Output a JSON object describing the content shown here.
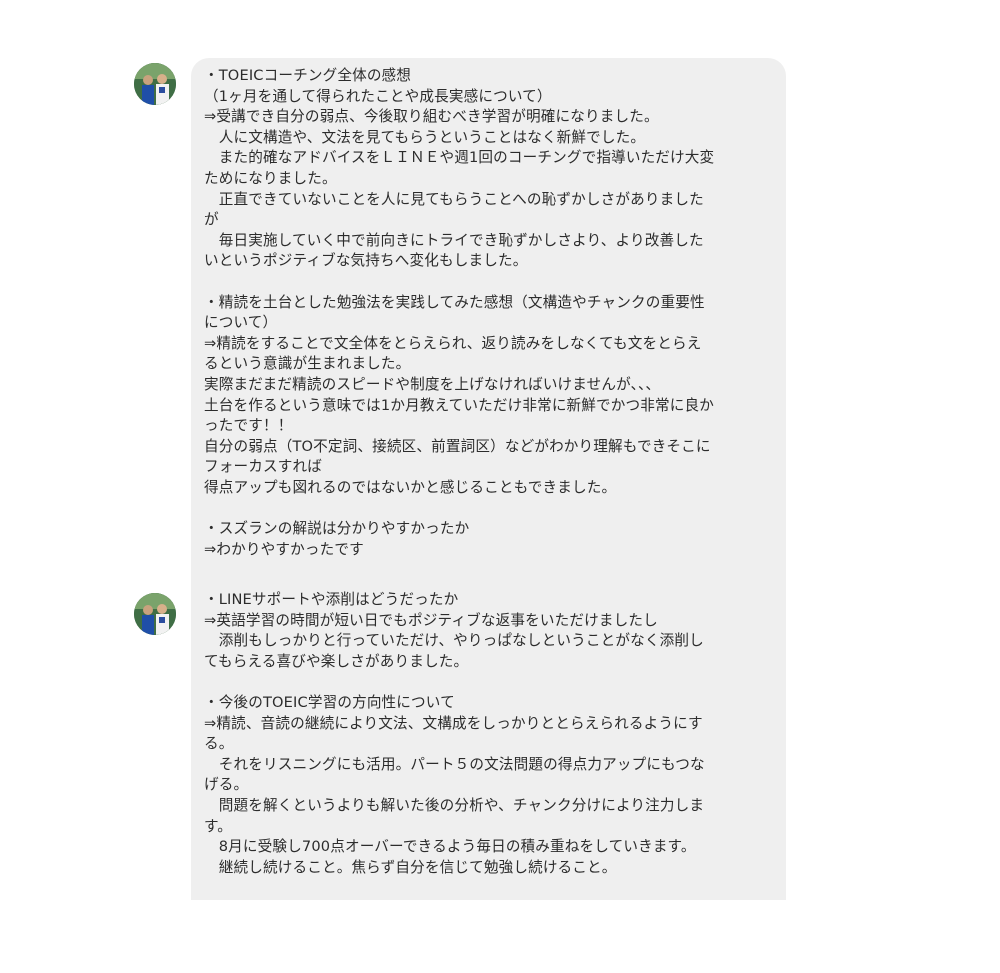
{
  "messages": [
    {
      "lines": [
        "・TOEICコーチング全体の感想",
        "（1ヶ月を通して得られたことや成長実感について）",
        "⇒受講でき自分の弱点、今後取り組むべき学習が明確になりました。",
        "　人に文構造や、文法を見てもらうということはなく新鮮でした。",
        "　また的確なアドバイスをＬＩＮＥや週1回のコーチングで指導いただけ大変",
        "ためになりました。",
        "　正直できていないことを人に見てもらうことへの恥ずかしさがありました",
        "が",
        "　毎日実施していく中で前向きにトライでき恥ずかしさより、より改善した",
        "いというポジティブな気持ちへ変化もしました。",
        "",
        "・精読を土台とした勉強法を実践してみた感想（文構造やチャンクの重要性",
        "について）",
        "⇒精読をすることで文全体をとらえられ、返り読みをしなくても文をとらえ",
        "るという意識が生まれました。",
        "実際まだまだ精読のスピードや制度を上げなければいけませんが、、、",
        "土台を作るという意味では1か月教えていただけ非常に新鮮でかつ非常に良か",
        "ったです！！",
        "自分の弱点（TO不定詞、接続区、前置詞区）などがわかり理解もできそこに",
        "フォーカスすれば",
        "得点アップも図れるのではないかと感じることもできました。",
        "",
        "・スズランの解説は分かりやすかったか",
        "⇒わかりやすかったです"
      ]
    },
    {
      "lines": [
        "・LINEサポートや添削はどうだったか",
        "⇒英語学習の時間が短い日でもポジティブな返事をいただけましたし",
        "　添削もしっかりと行っていただけ、やりっぱなしということがなく添削し",
        "てもらえる喜びや楽しさがありました。",
        "",
        "・今後のTOEIC学習の方向性について",
        "⇒精読、音読の継続により文法、文構成をしっかりととらえられるようにす",
        "る。",
        "　それをリスニングにも活用。パート５の文法問題の得点力アップにもつな",
        "げる。",
        "　問題を解くというよりも解いた後の分析や、チャンク分けにより注力しま",
        "す。",
        "　8月に受験し700点オーバーできるよう毎日の積み重ねをしていきます。",
        "　継続し続けること。焦らず自分を信じて勉強し続けること。"
      ]
    }
  ],
  "avatar_icon": "user-avatar-icon",
  "colors": {
    "bubble_bg": "#efefef",
    "text": "#2c2c2c",
    "page_bg": "#ffffff"
  }
}
